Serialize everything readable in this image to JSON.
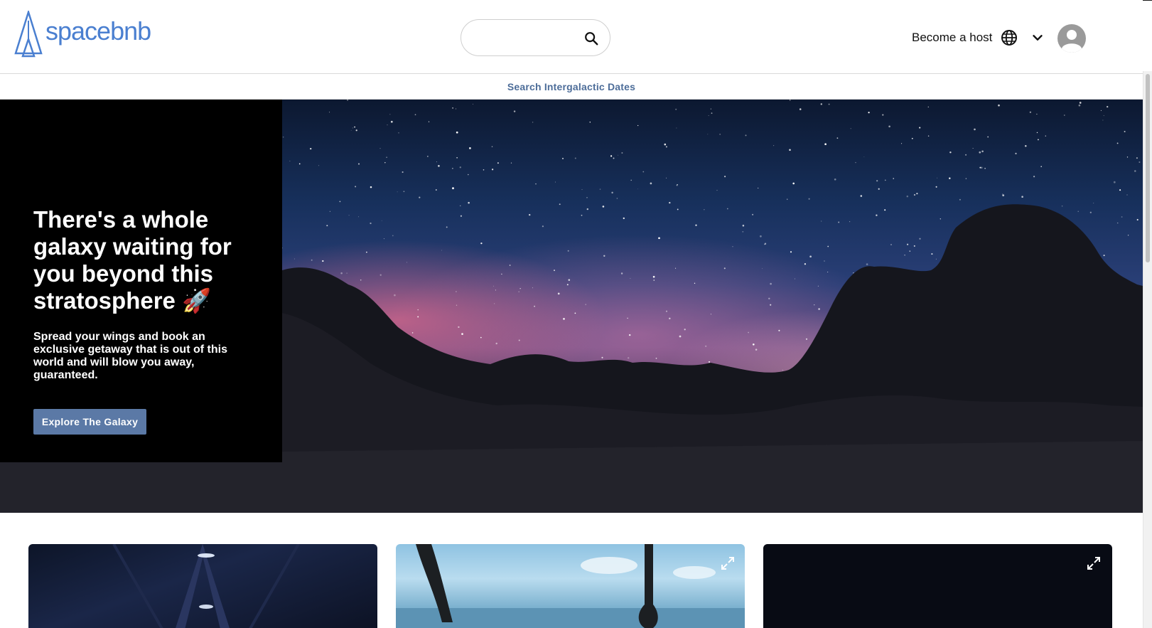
{
  "header": {
    "logo_text": "spacebnb",
    "logo_icon": "rocket-triangle-logo-icon",
    "search": {
      "value": "",
      "placeholder": "",
      "icon": "search-icon"
    },
    "become_host_label": "Become a host",
    "globe_icon": "globe-icon",
    "chevron_icon": "chevron-down-icon",
    "avatar_icon": "user-avatar-icon"
  },
  "subnav": {
    "link_label": "Search Intergalactic Dates"
  },
  "hero": {
    "title": "There's a whole galaxy waiting for you beyond this stratosphere 🚀",
    "subtitle": "Spread your wings and book an exclusive getaway that is out of this world and will blow you away, guaranteed.",
    "cta_label": "Explore The Galaxy"
  },
  "cards": [
    {
      "name": "card-spaceship-interior"
    },
    {
      "name": "card-helicopter-view",
      "icon": "expand-icon"
    },
    {
      "name": "card-dark-space",
      "icon": "expand-icon"
    }
  ],
  "colors": {
    "brand_blue": "#4a7fd0",
    "link_blue": "#4d6d99",
    "cta_button": "#5b79a6",
    "panel_black": "#000000"
  }
}
